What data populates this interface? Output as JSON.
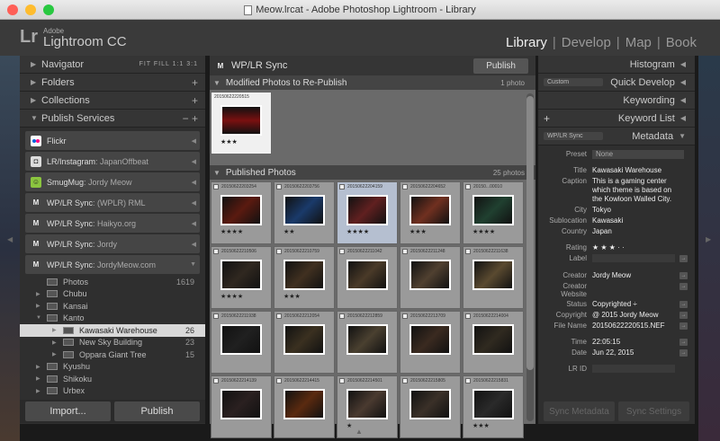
{
  "window": {
    "title": "Meow.lrcat - Adobe Photoshop Lightroom - Library"
  },
  "brand": {
    "lr": "Lr",
    "adobe": "Adobe",
    "product": "Lightroom CC"
  },
  "modules": [
    "Library",
    "Develop",
    "Map",
    "Book"
  ],
  "left": {
    "navigator": "Navigator",
    "nav_controls": "FIT  FILL  1:1  3:1",
    "folders": "Folders",
    "collections": "Collections",
    "publish_services": "Publish Services",
    "services": [
      {
        "name": "Flickr",
        "sub": ""
      },
      {
        "name": "LR/Instagram",
        "sub": " : JapanOffbeat"
      },
      {
        "name": "SmugMug",
        "sub": " : Jordy Meow"
      },
      {
        "name": "WP/LR Sync",
        "sub": " : (WPLR) RML"
      },
      {
        "name": "WP/LR Sync",
        "sub": " : Haikyo.org"
      },
      {
        "name": "WP/LR Sync",
        "sub": " : Jordy"
      },
      {
        "name": "WP/LR Sync",
        "sub": " : JordyMeow.com"
      }
    ],
    "tree": [
      {
        "name": "Photos",
        "count": "1619"
      },
      {
        "name": "Chubu",
        "count": ""
      },
      {
        "name": "Kansai",
        "count": ""
      },
      {
        "name": "Kanto",
        "count": ""
      },
      {
        "name": "Kawasaki Warehouse",
        "count": "26"
      },
      {
        "name": "New Sky Building",
        "count": "23"
      },
      {
        "name": "Oppara Giant Tree",
        "count": "15"
      },
      {
        "name": "Kyushu",
        "count": ""
      },
      {
        "name": "Shikoku",
        "count": ""
      },
      {
        "name": "Urbex",
        "count": ""
      }
    ],
    "import_btn": "Import...",
    "publish_btn": "Publish"
  },
  "center": {
    "title": "WP/LR Sync",
    "publish_btn": "Publish",
    "modified": {
      "label": "Modified Photos to Re-Publish",
      "count": "1 photo",
      "photo": {
        "id": "20150622220515",
        "stars": "★★★"
      }
    },
    "published": {
      "label": "Published Photos",
      "count": "25 photos"
    },
    "photos": [
      {
        "id": "20150622203254",
        "stars": "★★★★"
      },
      {
        "id": "20150622203756",
        "stars": "★★"
      },
      {
        "id": "20150622204159",
        "stars": "★★★★"
      },
      {
        "id": "20150622204652",
        "stars": "★★★"
      },
      {
        "id": "20150...00010",
        "stars": "★★★★"
      },
      {
        "id": "20150622210506",
        "stars": "★★★★"
      },
      {
        "id": "20150622210759",
        "stars": "★★★"
      },
      {
        "id": "20150622211042",
        "stars": ""
      },
      {
        "id": "20150622211248",
        "stars": ""
      },
      {
        "id": "20150622211638",
        "stars": ""
      },
      {
        "id": "20150622211938",
        "stars": ""
      },
      {
        "id": "20150622212054",
        "stars": ""
      },
      {
        "id": "20150622212859",
        "stars": ""
      },
      {
        "id": "20150622213709",
        "stars": ""
      },
      {
        "id": "20150622214004",
        "stars": ""
      },
      {
        "id": "20150622214139",
        "stars": ""
      },
      {
        "id": "20150622214415",
        "stars": ""
      },
      {
        "id": "20150622214501",
        "stars": "★"
      },
      {
        "id": "20150622215805",
        "stars": ""
      },
      {
        "id": "20150622215831",
        "stars": "★★★"
      }
    ]
  },
  "right": {
    "histogram": "Histogram",
    "custom": "Custom",
    "quick_develop": "Quick Develop",
    "keywording": "Keywording",
    "keyword_list": "Keyword List",
    "wplr_sel": "WP/LR Sync",
    "metadata": "Metadata",
    "preset_label": "Preset",
    "preset_value": "None",
    "fields": [
      {
        "k": "Title",
        "v": "Kawasaki Warehouse"
      },
      {
        "k": "Caption",
        "v": "This is a gaming center which theme is based on the Kowloon Walled City."
      },
      {
        "k": "City",
        "v": "Tokyo"
      },
      {
        "k": "Sublocation",
        "v": "Kawasaki"
      },
      {
        "k": "Country",
        "v": "Japan"
      }
    ],
    "rating_label": "Rating",
    "rating_value": "★ ★ ★  ·  ·",
    "label_label": "Label",
    "fields2": [
      {
        "k": "Creator",
        "v": "Jordy Meow"
      },
      {
        "k": "Creator Website",
        "v": ""
      },
      {
        "k": "Status",
        "v": "Copyrighted  ÷"
      },
      {
        "k": "Copyright",
        "v": "@ 2015 Jordy Meow"
      },
      {
        "k": "File Name",
        "v": "20150622220515.NEF"
      }
    ],
    "fields3": [
      {
        "k": "Time",
        "v": "22:05:15"
      },
      {
        "k": "Date",
        "v": "Jun 22, 2015"
      }
    ],
    "lrid_label": "LR ID",
    "sync_metadata": "Sync Metadata",
    "sync_settings": "Sync Settings"
  },
  "colors": {
    "red": "#ff5f57",
    "yellow": "#febc2e",
    "green": "#28c840",
    "flickr_blue": "#0063dc",
    "flickr_pink": "#ff0084",
    "smug": "#8bc53f"
  }
}
